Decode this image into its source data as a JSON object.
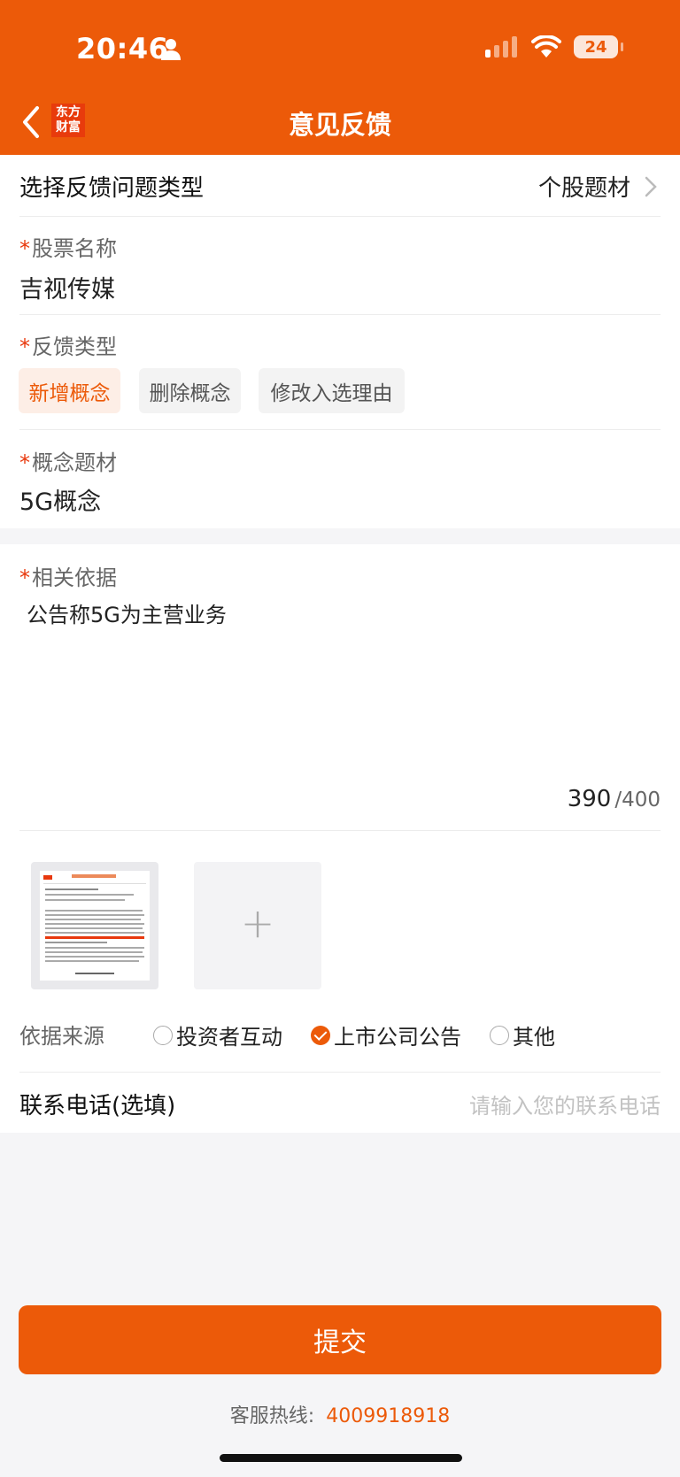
{
  "status_bar": {
    "time": "20:46",
    "battery": "24"
  },
  "nav": {
    "logo_line1": "东方",
    "logo_line2": "财富",
    "title": "意见反馈"
  },
  "category": {
    "label": "选择反馈问题类型",
    "value": "个股题材"
  },
  "stock": {
    "label": "股票名称",
    "value": "吉视传媒"
  },
  "feedback_type": {
    "label": "反馈类型",
    "options": [
      "新增概念",
      "删除概念",
      "修改入选理由"
    ],
    "selected": "新增概念"
  },
  "concept": {
    "label": "概念题材",
    "value": "5G概念"
  },
  "basis": {
    "label": "相关依据",
    "text": "公告称5G为主营业务",
    "count": "390",
    "max": "/400"
  },
  "attachments": {
    "add_symbol": "+"
  },
  "source": {
    "label": "依据来源",
    "options": [
      "投资者互动",
      "上市公司公告",
      "其他"
    ],
    "selected": "上市公司公告"
  },
  "phone": {
    "label": "联系电话(选填)",
    "placeholder": "请输入您的联系电话"
  },
  "submit_label": "提交",
  "hotline": {
    "label": "客服热线:",
    "number": "4009918918"
  },
  "colors": {
    "accent": "#ec5a09",
    "required_star": "#e8380d"
  }
}
